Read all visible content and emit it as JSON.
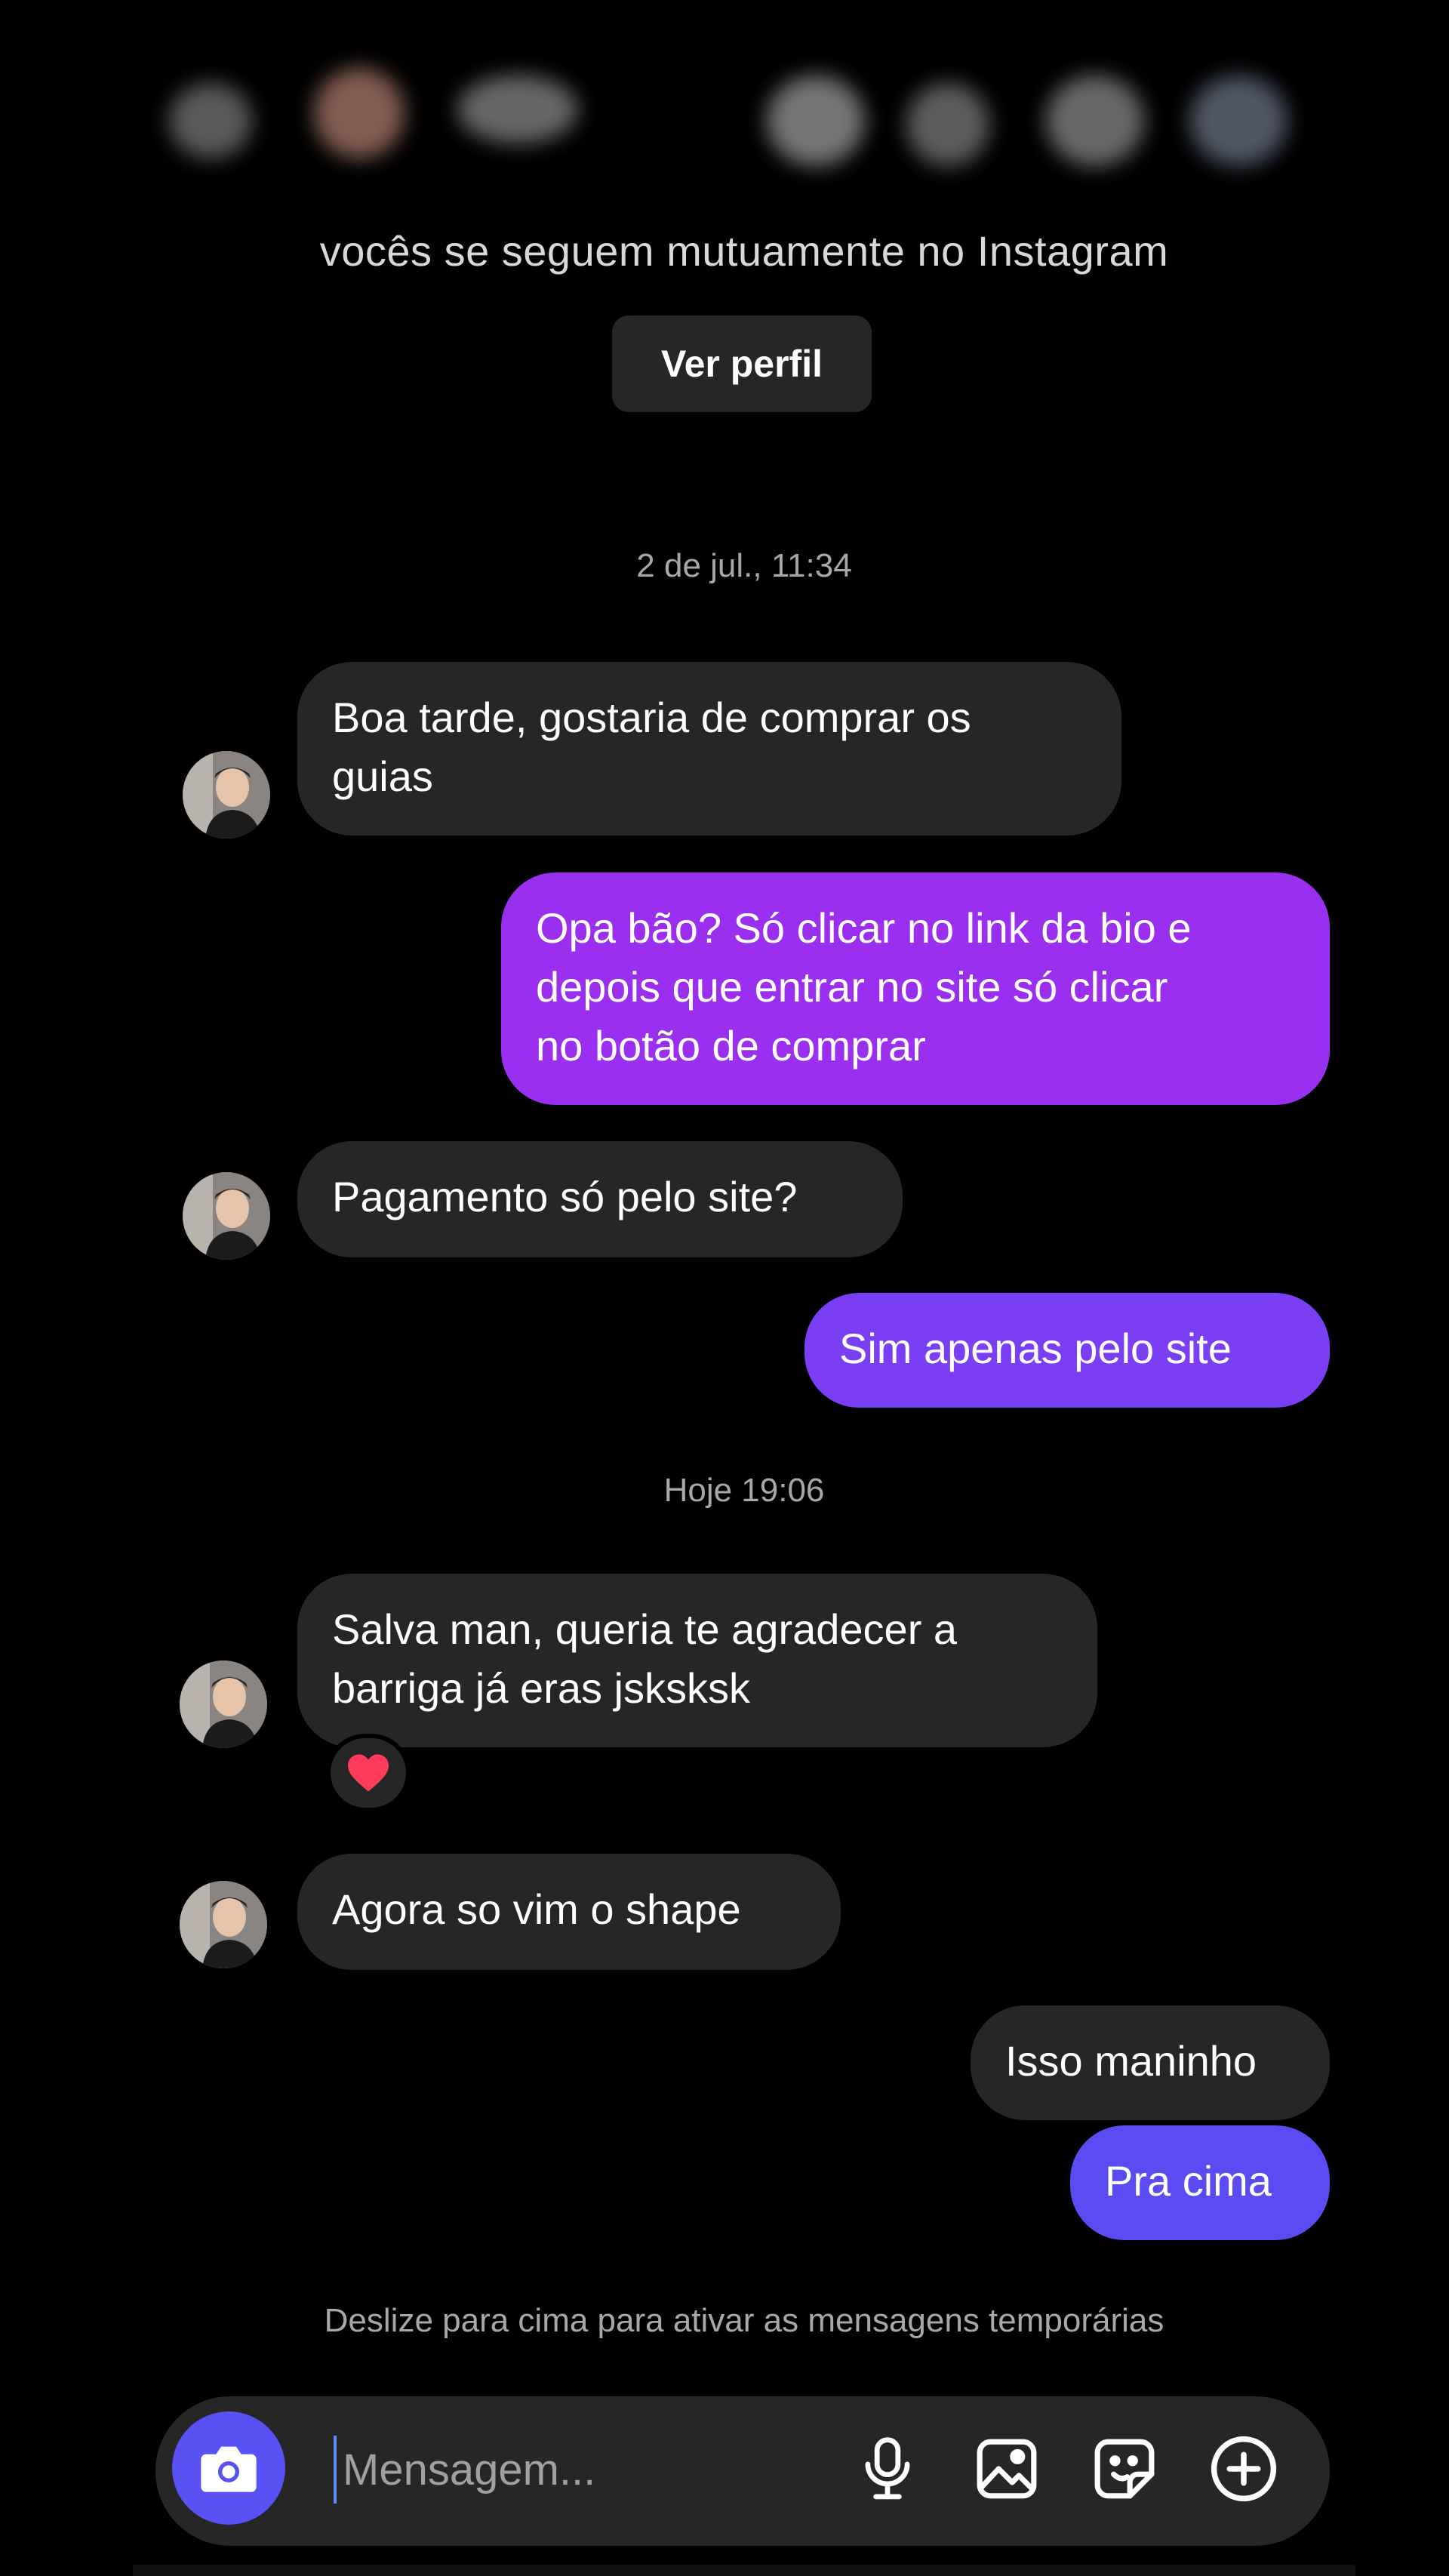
{
  "header": {
    "mutual_text": "vocês se seguem mutuamente no Instagram",
    "view_profile_label": "Ver perfil"
  },
  "timestamps": [
    "2 de jul., 11:34",
    "Hoje 19:06"
  ],
  "messages": [
    {
      "from": "them",
      "text": "Boa tarde, gostaria de comprar os\nguias"
    },
    {
      "from": "me",
      "text": "Opa bão? Só clicar no link da bio e\ndepois que entrar no site só clicar\nno botão de comprar"
    },
    {
      "from": "them",
      "text": "Pagamento só pelo site?"
    },
    {
      "from": "me",
      "text": "Sim apenas pelo site"
    },
    {
      "from": "them",
      "text": "Salva man, queria te agradecer a\nbarriga já eras jsksksk",
      "reaction": "heart"
    },
    {
      "from": "them",
      "text": "Agora so vim o shape"
    },
    {
      "from": "me",
      "text": "Isso maninho"
    },
    {
      "from": "me",
      "text": "Pra cima"
    }
  ],
  "hint_text": "Deslize para cima para ativar as mensagens temporárias",
  "composer": {
    "placeholder": "Mensagem...",
    "icons": [
      "camera-icon",
      "microphone-icon",
      "gallery-icon",
      "sticker-icon",
      "plus-icon"
    ]
  },
  "colors": {
    "incoming_bubble": "#262626",
    "outgoing_purple": "#9b2ff0",
    "outgoing_violet": "#7a3ff5",
    "outgoing_blue": "#5a4cf2",
    "camera_button": "#5851f4",
    "reaction_heart": "#ff3b5c"
  }
}
